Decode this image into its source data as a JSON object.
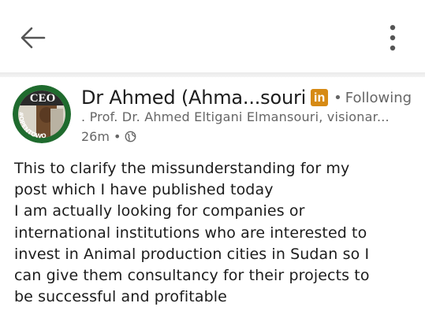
{
  "header": {
    "back_icon": "arrow-left-icon",
    "more_icon": "more-vertical-icon"
  },
  "author": {
    "name": "Dr Ahmed (Ahma...souri",
    "badge": "in",
    "separator": "•",
    "following_label": "Following",
    "headline": ". Prof. Dr. Ahmed Eltigani Elmansouri, visionar...",
    "time": "26m",
    "meta_separator": "•",
    "visibility_icon": "globe-icon",
    "avatar": {
      "frame_text": "#OPENTOWORK",
      "magazine_title": "CEO",
      "frame_color": "#1f6b2e"
    }
  },
  "post": {
    "text": "This to clarify the missunderstanding for my\npost which I have published today\nI am actually looking for companies or\ninternational institutions who are interested to\ninvest in Animal production cities in Sudan so I\ncan give them consultancy for their projects to\nbe successful and profitable"
  }
}
